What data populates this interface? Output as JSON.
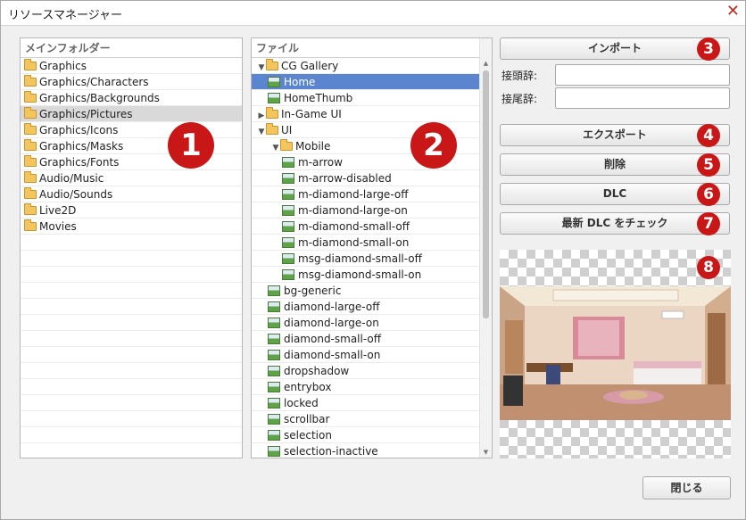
{
  "window": {
    "title": "リソースマネージャー",
    "close_glyph": "✕"
  },
  "folders_panel": {
    "header": "メインフォルダー",
    "items": [
      {
        "label": "Graphics"
      },
      {
        "label": "Graphics/Characters"
      },
      {
        "label": "Graphics/Backgrounds"
      },
      {
        "label": "Graphics/Pictures",
        "selected": true
      },
      {
        "label": "Graphics/Icons"
      },
      {
        "label": "Graphics/Masks"
      },
      {
        "label": "Graphics/Fonts"
      },
      {
        "label": "Audio/Music"
      },
      {
        "label": "Audio/Sounds"
      },
      {
        "label": "Live2D"
      },
      {
        "label": "Movies"
      }
    ]
  },
  "files_panel": {
    "header": "ファイル",
    "items": [
      {
        "label": "CG Gallery",
        "type": "folder",
        "depth": 0,
        "expander": "▼"
      },
      {
        "label": "Home",
        "type": "image",
        "depth": 1,
        "selected": true
      },
      {
        "label": "HomeThumb",
        "type": "image",
        "depth": 1
      },
      {
        "label": "In-Game UI",
        "type": "folder",
        "depth": 0,
        "expander": "▶"
      },
      {
        "label": "UI",
        "type": "folder",
        "depth": 0,
        "expander": "▼"
      },
      {
        "label": "Mobile",
        "type": "folder",
        "depth": 1,
        "expander": "▼"
      },
      {
        "label": "m-arrow",
        "type": "image",
        "depth": 2
      },
      {
        "label": "m-arrow-disabled",
        "type": "image",
        "depth": 2
      },
      {
        "label": "m-diamond-large-off",
        "type": "image",
        "depth": 2
      },
      {
        "label": "m-diamond-large-on",
        "type": "image",
        "depth": 2
      },
      {
        "label": "m-diamond-small-off",
        "type": "image",
        "depth": 2
      },
      {
        "label": "m-diamond-small-on",
        "type": "image",
        "depth": 2
      },
      {
        "label": "msg-diamond-small-off",
        "type": "image",
        "depth": 2
      },
      {
        "label": "msg-diamond-small-on",
        "type": "image",
        "depth": 2
      },
      {
        "label": "bg-generic",
        "type": "image",
        "depth": 1
      },
      {
        "label": "diamond-large-off",
        "type": "image",
        "depth": 1
      },
      {
        "label": "diamond-large-on",
        "type": "image",
        "depth": 1
      },
      {
        "label": "diamond-small-off",
        "type": "image",
        "depth": 1
      },
      {
        "label": "diamond-small-on",
        "type": "image",
        "depth": 1
      },
      {
        "label": "dropshadow",
        "type": "image",
        "depth": 1
      },
      {
        "label": "entrybox",
        "type": "image",
        "depth": 1
      },
      {
        "label": "locked",
        "type": "image",
        "depth": 1
      },
      {
        "label": "scrollbar",
        "type": "image",
        "depth": 1
      },
      {
        "label": "selection",
        "type": "image",
        "depth": 1
      },
      {
        "label": "selection-inactive",
        "type": "image",
        "depth": 1
      }
    ]
  },
  "actions": {
    "import_label": "インポート",
    "prefix_label": "接頭辞:",
    "prefix_value": "",
    "suffix_label": "接尾辞:",
    "suffix_value": "",
    "export_label": "エクスポート",
    "delete_label": "削除",
    "dlc_label": "DLC",
    "check_dlc_label": "最新 DLC をチェック"
  },
  "footer": {
    "close_label": "閉じる"
  },
  "badges": {
    "b1": "1",
    "b2": "2",
    "b3": "3",
    "b4": "4",
    "b5": "5",
    "b6": "6",
    "b7": "7",
    "b8": "8"
  },
  "colors": {
    "badge": "#c91616",
    "selection_blue": "#5b86cf",
    "selection_gray": "#d9d9d9"
  }
}
